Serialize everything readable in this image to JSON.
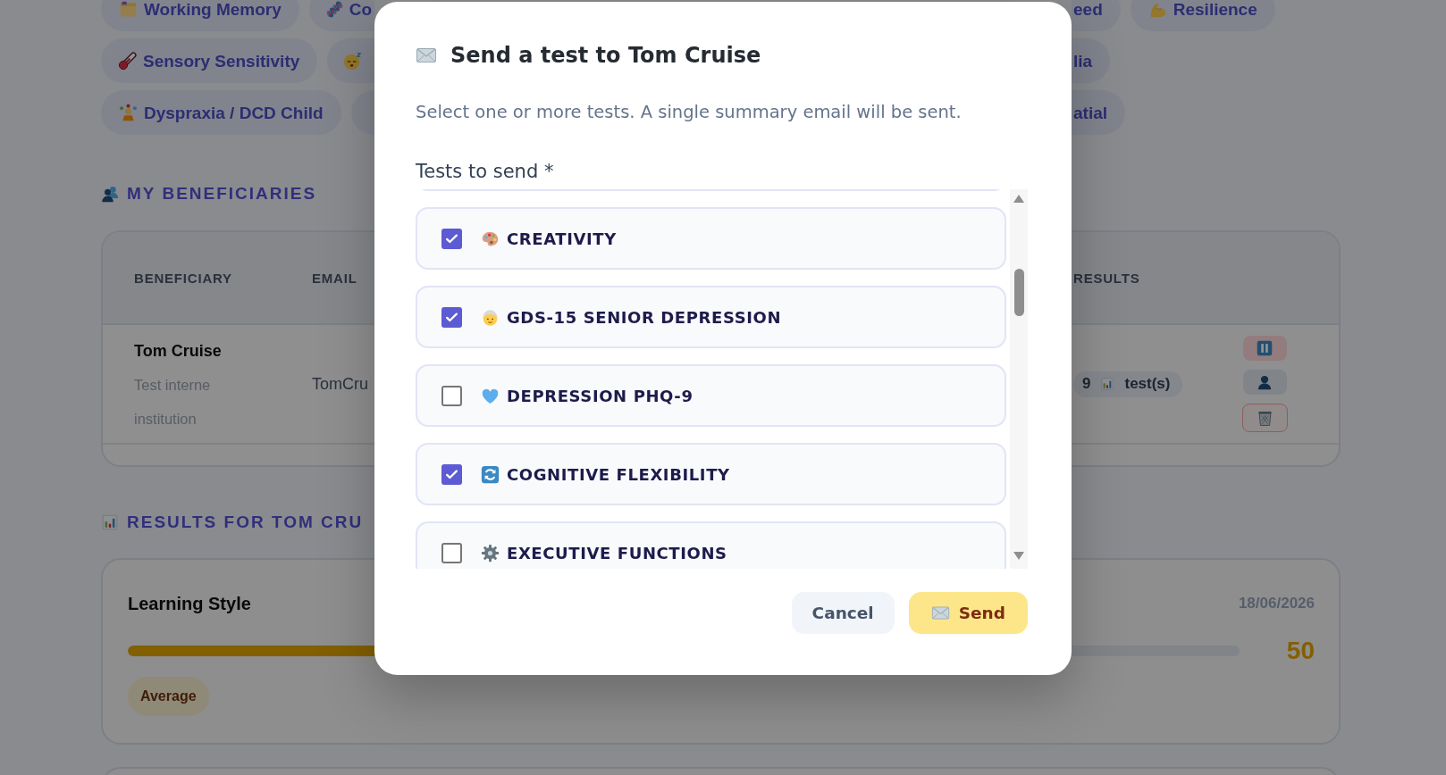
{
  "test_tags": {
    "rows": [
      {
        "tags": [
          {
            "kind": "full",
            "label": "Working Memory"
          },
          {
            "kind": "cut_right",
            "label": "Co"
          },
          {
            "kind": "cut_left",
            "label": "eed"
          },
          {
            "kind": "full",
            "label": "Resilience"
          }
        ]
      },
      {
        "tags": [
          {
            "kind": "full",
            "label": "Sensory Sensitivity"
          },
          {
            "kind": "cut_right"
          },
          {
            "kind": "cut_left",
            "label": "lia"
          }
        ]
      },
      {
        "tags": [
          {
            "kind": "full",
            "label": "Dyspraxia / DCD Child"
          },
          {
            "kind": "cut_right"
          },
          {
            "kind": "cut_left",
            "label": "atial"
          }
        ]
      }
    ]
  },
  "beneficiaries": {
    "heading": "MY BENEFICIARIES",
    "columns": [
      "BENEFICIARY",
      "EMAIL",
      "RESULTS"
    ],
    "rows": [
      {
        "name": "Tom Cruise",
        "details": [
          "Test interne",
          "institution"
        ],
        "email": "TomCru",
        "results_count": "9",
        "results_label": "test(s)"
      }
    ]
  },
  "results": {
    "heading": "RESULTS FOR TOM CRU",
    "cards": [
      {
        "title": "Learning Style",
        "date": "18/06/2026",
        "level": 0.5,
        "score": "50",
        "rating": "Average"
      }
    ]
  },
  "dialog": {
    "title": "Send a test to Tom Cruise",
    "description": "Select one or more tests. A single summary email will be sent.",
    "field_label": "Tests to send *",
    "tests": [
      {
        "label": "CREATIVITY",
        "checked": true
      },
      {
        "label": "GDS-15 SENIOR DEPRESSION",
        "checked": true
      },
      {
        "label": "DEPRESSION PHQ-9",
        "checked": false
      },
      {
        "label": "COGNITIVE FLEXIBILITY",
        "checked": true
      },
      {
        "label": "EXECUTIVE FUNCTIONS",
        "checked": false
      }
    ],
    "buttons": [
      {
        "label": "Cancel",
        "kind": "secondary"
      },
      {
        "label": "Send",
        "kind": "primary"
      }
    ]
  }
}
